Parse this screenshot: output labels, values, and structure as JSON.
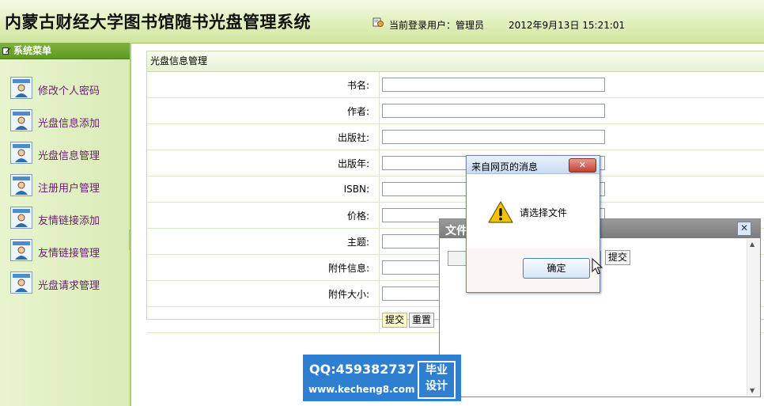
{
  "header": {
    "title": "内蒙古财经大学图书馆随书光盘管理系统",
    "user_label": "当前登录用户：管理员",
    "datetime": "2012年9月13日 15:21:01"
  },
  "sidebar": {
    "heading": "系统菜单",
    "items": [
      {
        "label": "修改个人密码",
        "icon": "user-icon"
      },
      {
        "label": "光盘信息添加",
        "icon": "user-icon"
      },
      {
        "label": "光盘信息管理",
        "icon": "user-icon"
      },
      {
        "label": "注册用户管理",
        "icon": "user-icon"
      },
      {
        "label": "友情链接添加",
        "icon": "user-icon"
      },
      {
        "label": "友情链接管理",
        "icon": "user-icon"
      },
      {
        "label": "光盘请求管理",
        "icon": "user-icon"
      }
    ]
  },
  "main": {
    "panel_title": "光盘信息管理",
    "fields": [
      {
        "label": "书名:",
        "value": ""
      },
      {
        "label": "作者:",
        "value": ""
      },
      {
        "label": "出版社:",
        "value": ""
      },
      {
        "label": "出版年:",
        "value": ""
      },
      {
        "label": "ISBN:",
        "value": ""
      },
      {
        "label": "价格:",
        "value": ""
      },
      {
        "label": "主题:",
        "value": ""
      },
      {
        "label": "附件信息:",
        "value": ""
      },
      {
        "label": "附件大小:",
        "value": ""
      }
    ],
    "submit_label": "提交",
    "reset_label": "重置"
  },
  "file_window": {
    "title": "文件",
    "close_label": "✕",
    "submit_label": "提交"
  },
  "alert": {
    "title": "来自网页的消息",
    "close_label": "✕",
    "message": "请选择文件",
    "ok_label": "确定",
    "icon": "warning-icon"
  },
  "watermark": {
    "qq": "QQ:459382737",
    "site": "www.kecheng8.com",
    "tag_line1": "毕业",
    "tag_line2": "设计"
  },
  "colors": {
    "menu_text": "#6a1c70",
    "menu_head": "#6fa82e",
    "watermark_bg": "#2f7fd0"
  }
}
